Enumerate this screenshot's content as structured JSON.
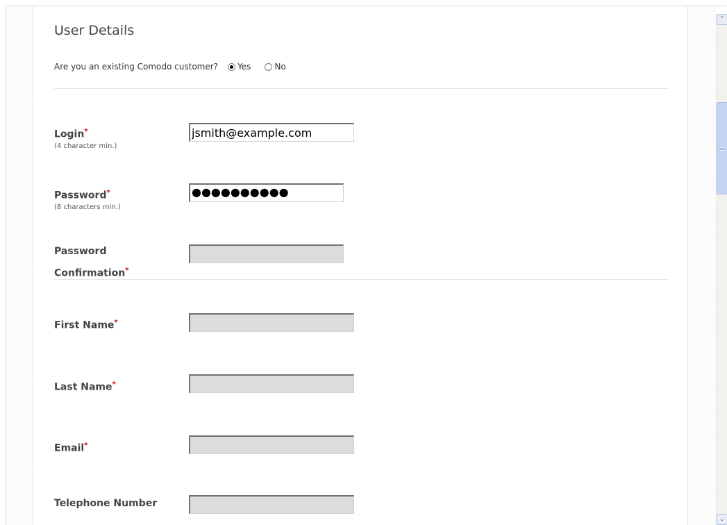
{
  "section": {
    "title": "User Details"
  },
  "existing_customer": {
    "question": "Are you an existing Comodo customer?",
    "options": [
      {
        "label": "Yes",
        "selected": true
      },
      {
        "label": "No",
        "selected": false
      }
    ]
  },
  "required_marker": "*",
  "fields": {
    "login": {
      "label": "Login",
      "required": true,
      "hint": "(4 character min.)",
      "value": "jsmith@example.com"
    },
    "password": {
      "label": "Password",
      "required": true,
      "hint": "(8 characters min.)",
      "masked_value": "●●●●●●●●●●"
    },
    "password_confirmation": {
      "label_line1": "Password",
      "label_line2": "Confirmation",
      "required": true,
      "value": ""
    },
    "first_name": {
      "label": "First Name",
      "required": true,
      "value": ""
    },
    "last_name": {
      "label": "Last Name",
      "required": true,
      "value": ""
    },
    "email": {
      "label": "Email",
      "required": true,
      "value": ""
    },
    "telephone": {
      "label": "Telephone Number",
      "required": false,
      "value": ""
    }
  },
  "scrollbar": {
    "up_icon": "chevron-up-icon",
    "down_icon": "chevron-down-icon",
    "up_glyph": "⌃",
    "down_glyph": "⌄"
  },
  "colors": {
    "required": "#cc0000",
    "disabled_input": "#dcdcdc",
    "scroll_thumb": "#c5d5f1"
  }
}
